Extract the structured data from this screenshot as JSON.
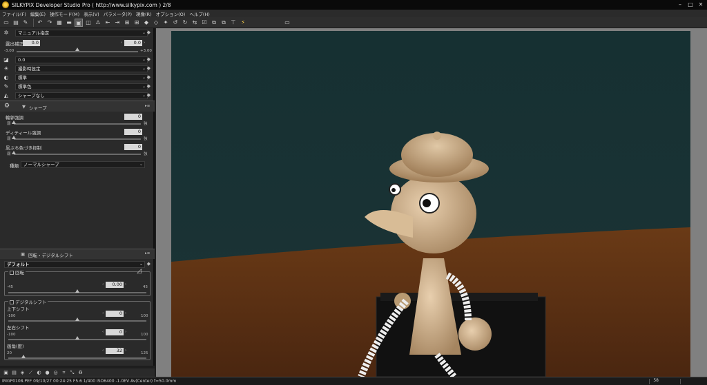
{
  "window": {
    "title": "SILKYPIX Developer Studio Pro ( http://www.silkypix.com )   2/8"
  },
  "menu": [
    "ファイル(F)",
    "編集(E)",
    "操作モード(M)",
    "表示(V)",
    "パラメータ(P)",
    "現像(R)",
    "オプション(O)",
    "ヘルプ(H)"
  ],
  "panel": {
    "tone_preset": "マニュアル指定",
    "exposure": {
      "label": "露出補正",
      "value": "0.0",
      "value2": "0.0",
      "min": "-3.00",
      "max": "+3.00",
      "level": 0.5
    },
    "row_gamma": "0.0",
    "white_balance": "撮影時設定",
    "row_tone": "標準",
    "row_color": "標準色",
    "row_sharp": "シャープなし",
    "sharp_section": {
      "title": "シャープ",
      "sliders": [
        {
          "label": "輪郭強調",
          "value": "0",
          "min": "弱",
          "max": "強",
          "level": 0.0
        },
        {
          "label": "ディティール強調",
          "value": "0",
          "min": "弱",
          "max": "強",
          "level": 0.0
        },
        {
          "label": "黒ぶち色づき抑制",
          "value": "0",
          "min": "弱",
          "max": "強",
          "level": 0.0
        }
      ],
      "type_label": "種類",
      "type_value": "ノーマルシャープ"
    },
    "rotation_section": {
      "title": "回転・デジタルシフト",
      "preset": "デフォルト",
      "rotate": {
        "label": "回転",
        "value": "0.00",
        "min": "-45",
        "max": "45",
        "level": 0.5
      },
      "shift_group": "デジタルシフト",
      "vertical": {
        "label": "上下シフト",
        "value": "0",
        "min": "-100",
        "max": "100",
        "level": 0.5
      },
      "horizontal": {
        "label": "左右シフト",
        "value": "0",
        "min": "-100",
        "max": "100",
        "level": 0.5
      },
      "angle": {
        "label": "画角(度)",
        "value": "32",
        "min": "20",
        "max": "125",
        "level": 0.11
      }
    }
  },
  "status": {
    "text": "IMGP0108.PEF 09/10/27 00:24:25 F5.6 1/400 ISO6400 -1.0EV Av(Center) f=50.0mm",
    "zoom": "58"
  },
  "colors": {
    "accent": "#ffd24a",
    "panel": "#2a2a2a",
    "viewer_bg": "#808080"
  }
}
